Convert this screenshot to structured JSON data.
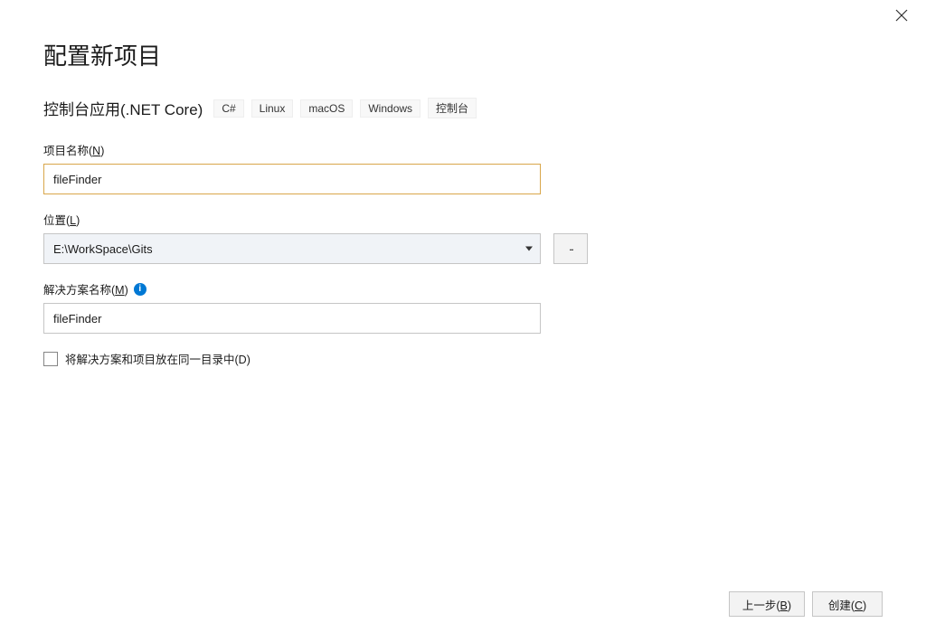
{
  "title": "配置新项目",
  "subtitle": "控制台应用(.NET Core)",
  "tags": [
    "C#",
    "Linux",
    "macOS",
    "Windows",
    "控制台"
  ],
  "fields": {
    "projectName": {
      "label_prefix": "项目名称(",
      "label_key": "N",
      "label_suffix": ")",
      "value": "fileFinder"
    },
    "location": {
      "label_prefix": "位置(",
      "label_key": "L",
      "label_suffix": ")",
      "value": "E:\\WorkSpace\\Gits"
    },
    "solutionName": {
      "label_prefix": "解决方案名称(",
      "label_key": "M",
      "label_suffix": ")",
      "value": "fileFinder"
    },
    "sameDir": {
      "label_prefix": "将解决方案和项目放在同一目录中(",
      "label_key": "D",
      "label_suffix": ")",
      "checked": false
    }
  },
  "buttons": {
    "browse": "...",
    "back_prefix": "上一步(",
    "back_key": "B",
    "back_suffix": ")",
    "create_prefix": "创建(",
    "create_key": "C",
    "create_suffix": ")"
  }
}
